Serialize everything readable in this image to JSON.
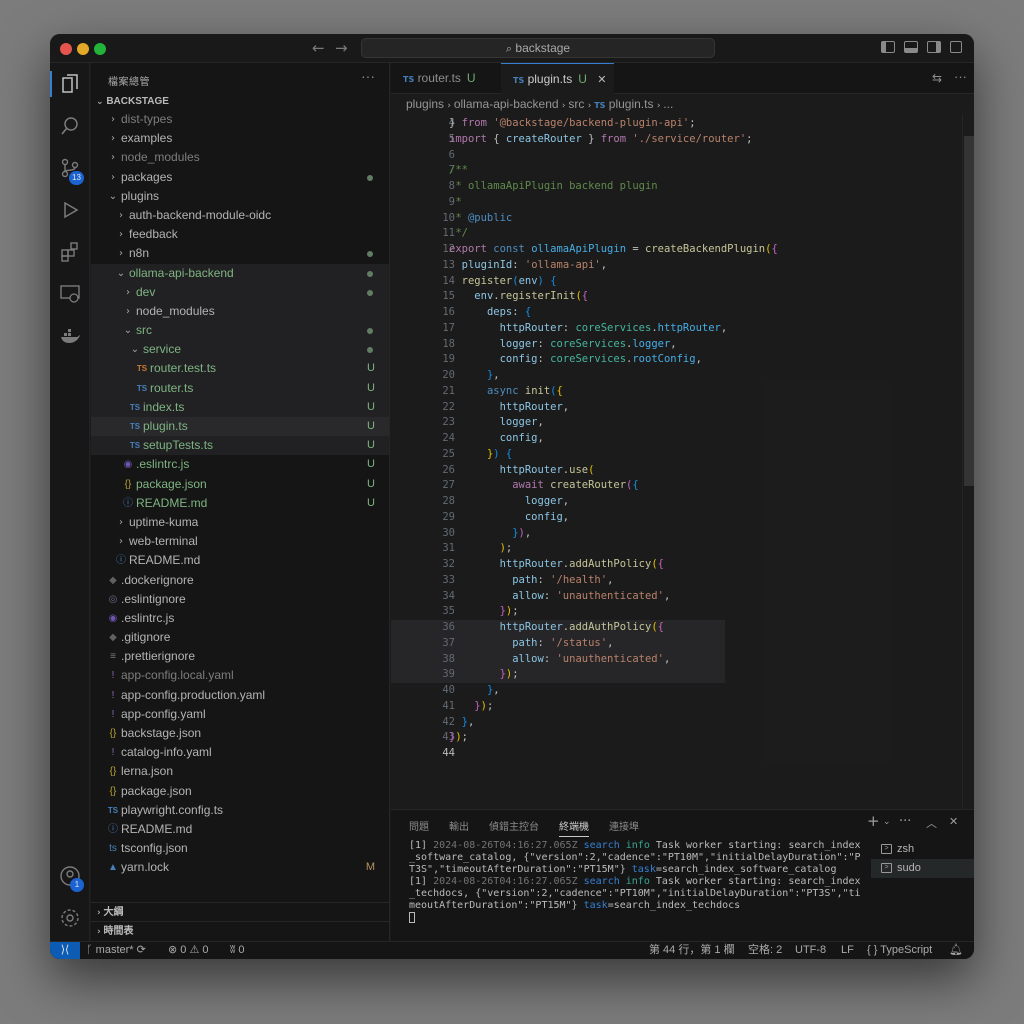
{
  "titlebar": {
    "search": "backstage"
  },
  "activity": {
    "scm_badge": "13",
    "account_badge": "1"
  },
  "sidebar": {
    "title": "檔案總管",
    "more": "···",
    "root": "BACKSTAGE",
    "tree": [
      {
        "label": "dist-types",
        "indent": 13,
        "chev": "›",
        "dim": true
      },
      {
        "label": "examples",
        "indent": 13,
        "chev": "›"
      },
      {
        "label": "node_modules",
        "indent": 13,
        "chev": "›",
        "dim": true
      },
      {
        "label": "packages",
        "indent": 13,
        "chev": "›",
        "dot": true
      },
      {
        "label": "plugins",
        "indent": 13,
        "chev": "⌄"
      },
      {
        "label": "auth-backend-module-oidc",
        "indent": 21,
        "chev": "›"
      },
      {
        "label": "feedback",
        "indent": 21,
        "chev": "›"
      },
      {
        "label": "n8n",
        "indent": 21,
        "chev": "›",
        "dot": true
      },
      {
        "label": "ollama-api-backend",
        "indent": 21,
        "chev": "⌄",
        "green": true,
        "dot": true,
        "hl": true
      },
      {
        "label": "dev",
        "indent": 28,
        "chev": "›",
        "green": true,
        "dot": true,
        "hl": true
      },
      {
        "label": "node_modules",
        "indent": 28,
        "chev": "›",
        "hl": true
      },
      {
        "label": "src",
        "indent": 28,
        "chev": "⌄",
        "green": true,
        "dot": true,
        "hl": true
      },
      {
        "label": "service",
        "indent": 35,
        "chev": "⌄",
        "green": true,
        "dot": true,
        "hl": true
      },
      {
        "label": "router.test.ts",
        "indent": 42,
        "icon": "TS",
        "iconColor": "#e0883a",
        "green": true,
        "status": "U",
        "hl": true
      },
      {
        "label": "router.ts",
        "indent": 42,
        "icon": "TS",
        "green": true,
        "status": "U",
        "hl": true
      },
      {
        "label": "index.ts",
        "indent": 35,
        "icon": "TS",
        "green": true,
        "status": "U",
        "hl": true
      },
      {
        "label": "plugin.ts",
        "indent": 35,
        "icon": "TS",
        "green": true,
        "status": "U",
        "sel": true
      },
      {
        "label": "setupTests.ts",
        "indent": 35,
        "icon": "TS",
        "green": true,
        "status": "U",
        "hl": true
      },
      {
        "label": ".eslintrc.js",
        "indent": 28,
        "icon": "◉",
        "iconColor": "#7b5fc4",
        "green": true,
        "status": "U"
      },
      {
        "label": "package.json",
        "indent": 28,
        "icon": "{}",
        "iconColor": "#c9b43a",
        "green": true,
        "status": "U"
      },
      {
        "label": "README.md",
        "indent": 28,
        "icon": "ⓘ",
        "iconColor": "#4e8fd1",
        "green": true,
        "status": "U"
      },
      {
        "label": "uptime-kuma",
        "indent": 21,
        "chev": "›"
      },
      {
        "label": "web-terminal",
        "indent": 21,
        "chev": "›"
      },
      {
        "label": "README.md",
        "indent": 21,
        "icon": "ⓘ",
        "iconColor": "#4e8fd1"
      },
      {
        "label": ".dockerignore",
        "indent": 13,
        "icon": "◆",
        "iconColor": "#6b6b6b"
      },
      {
        "label": ".eslintignore",
        "indent": 13,
        "icon": "◎",
        "iconColor": "#7b7b9b"
      },
      {
        "label": ".eslintrc.js",
        "indent": 13,
        "icon": "◉",
        "iconColor": "#7b5fc4"
      },
      {
        "label": ".gitignore",
        "indent": 13,
        "icon": "◆",
        "iconColor": "#6b6b6b"
      },
      {
        "label": ".prettierignore",
        "indent": 13,
        "icon": "≡",
        "iconColor": "#8a8a8a"
      },
      {
        "label": "app-config.local.yaml",
        "indent": 13,
        "icon": "!",
        "iconColor": "#a074c4",
        "dim": true
      },
      {
        "label": "app-config.production.yaml",
        "indent": 13,
        "icon": "!",
        "iconColor": "#a074c4"
      },
      {
        "label": "app-config.yaml",
        "indent": 13,
        "icon": "!",
        "iconColor": "#a074c4"
      },
      {
        "label": "backstage.json",
        "indent": 13,
        "icon": "{}",
        "iconColor": "#c9b43a"
      },
      {
        "label": "catalog-info.yaml",
        "indent": 13,
        "icon": "!",
        "iconColor": "#a074c4"
      },
      {
        "label": "lerna.json",
        "indent": 13,
        "icon": "{}",
        "iconColor": "#c9b43a"
      },
      {
        "label": "package.json",
        "indent": 13,
        "icon": "{}",
        "iconColor": "#c9b43a"
      },
      {
        "label": "playwright.config.ts",
        "indent": 13,
        "icon": "TS"
      },
      {
        "label": "README.md",
        "indent": 13,
        "icon": "ⓘ",
        "iconColor": "#4e8fd1"
      },
      {
        "label": "tsconfig.json",
        "indent": 13,
        "icon": "ts",
        "iconColor": "#4e8fd1"
      },
      {
        "label": "yarn.lock",
        "indent": 13,
        "icon": "▲",
        "iconColor": "#4e8fd1",
        "status": "M",
        "statusColor": "#c9a26b"
      }
    ],
    "outline": "大綱",
    "timeline": "時間表"
  },
  "tabs": [
    {
      "label": "router.ts",
      "status": "U",
      "active": false
    },
    {
      "label": "plugin.ts",
      "status": "U",
      "active": true
    }
  ],
  "breadcrumb": [
    "plugins",
    "ollama-api-backend",
    "src",
    "plugin.ts",
    "..."
  ],
  "code": {
    "lines": [
      {
        "n": 4,
        "html": "<span style=\"color:#cfcfcf\">} </span><span style=\"color:#c586c0\">from</span> <span style=\"color:#ce9178\">'@backstage/backend-plugin-api'</span>;"
      },
      {
        "n": 5,
        "html": "<span style=\"color:#c586c0\">import</span> { <span style=\"color:#9cdcfe\">createRouter</span> } <span style=\"color:#c586c0\">from</span> <span style=\"color:#ce9178\">'./service/router'</span>;"
      },
      {
        "n": 6,
        "html": ""
      },
      {
        "n": 7,
        "html": "<span style=\"color:#6a9955\">/**</span>"
      },
      {
        "n": 8,
        "html": "<span style=\"color:#6a9955\"> * ollamaApiPlugin backend plugin</span>"
      },
      {
        "n": 9,
        "html": "<span style=\"color:#6a9955\"> *</span>"
      },
      {
        "n": 10,
        "html": "<span style=\"color:#6a9955\"> * </span><span style=\"color:#569cd6\">@public</span>"
      },
      {
        "n": 11,
        "html": "<span style=\"color:#6a9955\"> */</span>"
      },
      {
        "n": 12,
        "html": "<span style=\"color:#c586c0\">export</span> <span style=\"color:#569cd6\">const</span> <span style=\"color:#4fc1ff\">ollamaApiPlugin</span> = <span style=\"color:#dcdcaa\">createBackendPlugin</span><span style=\"color:#ffd700\">(</span><span style=\"color:#da70d6\">{</span>"
      },
      {
        "n": 13,
        "html": "  <span style=\"color:#9cdcfe\">pluginId</span>: <span style=\"color:#ce9178\">'ollama-api'</span>,"
      },
      {
        "n": 14,
        "html": "  <span style=\"color:#dcdcaa\">register</span><span style=\"color:#179fff\">(</span><span style=\"color:#9cdcfe\">env</span><span style=\"color:#179fff\">)</span> <span style=\"color:#179fff\">{</span>"
      },
      {
        "n": 15,
        "html": "    <span style=\"color:#9cdcfe\">env</span>.<span style=\"color:#dcdcaa\">registerInit</span><span style=\"color:#ffd700\">(</span><span style=\"color:#da70d6\">{</span>"
      },
      {
        "n": 16,
        "html": "      <span style=\"color:#9cdcfe\">deps</span>: <span style=\"color:#179fff\">{</span>"
      },
      {
        "n": 17,
        "html": "        <span style=\"color:#9cdcfe\">httpRouter</span>: <span style=\"color:#4ec9b0\">coreServices</span>.<span style=\"color:#4fc1ff\">httpRouter</span>,"
      },
      {
        "n": 18,
        "html": "        <span style=\"color:#9cdcfe\">logger</span>: <span style=\"color:#4ec9b0\">coreServices</span>.<span style=\"color:#4fc1ff\">logger</span>,"
      },
      {
        "n": 19,
        "html": "        <span style=\"color:#9cdcfe\">config</span>: <span style=\"color:#4ec9b0\">coreServices</span>.<span style=\"color:#4fc1ff\">rootConfig</span>,"
      },
      {
        "n": 20,
        "html": "      <span style=\"color:#179fff\">}</span>,"
      },
      {
        "n": 21,
        "html": "      <span style=\"color:#569cd6\">async</span> <span style=\"color:#dcdcaa\">init</span><span style=\"color:#179fff\">(</span><span style=\"color:#ffd700\">{</span>"
      },
      {
        "n": 22,
        "html": "        <span style=\"color:#9cdcfe\">httpRouter</span>,"
      },
      {
        "n": 23,
        "html": "        <span style=\"color:#9cdcfe\">logger</span>,"
      },
      {
        "n": 24,
        "html": "        <span style=\"color:#9cdcfe\">config</span>,"
      },
      {
        "n": 25,
        "html": "      <span style=\"color:#ffd700\">}</span><span style=\"color:#179fff\">)</span> <span style=\"color:#179fff\">{</span>"
      },
      {
        "n": 26,
        "html": "        <span style=\"color:#9cdcfe\">httpRouter</span>.<span style=\"color:#dcdcaa\">use</span><span style=\"color:#ffd700\">(</span>"
      },
      {
        "n": 27,
        "html": "          <span style=\"color:#c586c0\">await</span> <span style=\"color:#dcdcaa\">createRouter</span><span style=\"color:#da70d6\">(</span><span style=\"color:#179fff\">{</span>"
      },
      {
        "n": 28,
        "html": "            <span style=\"color:#9cdcfe\">logger</span>,"
      },
      {
        "n": 29,
        "html": "            <span style=\"color:#9cdcfe\">config</span>,"
      },
      {
        "n": 30,
        "html": "          <span style=\"color:#179fff\">}</span><span style=\"color:#da70d6\">)</span>,"
      },
      {
        "n": 31,
        "html": "        <span style=\"color:#ffd700\">)</span>;"
      },
      {
        "n": 32,
        "html": "        <span style=\"color:#9cdcfe\">httpRouter</span>.<span style=\"color:#dcdcaa\">addAuthPolicy</span><span style=\"color:#ffd700\">(</span><span style=\"color:#da70d6\">{</span>"
      },
      {
        "n": 33,
        "html": "          <span style=\"color:#9cdcfe\">path</span>: <span style=\"color:#ce9178\">'/health'</span>,"
      },
      {
        "n": 34,
        "html": "          <span style=\"color:#9cdcfe\">allow</span>: <span style=\"color:#ce9178\">'unauthenticated'</span>,"
      },
      {
        "n": 35,
        "html": "        <span style=\"color:#da70d6\">}</span><span style=\"color:#ffd700\">)</span>;"
      },
      {
        "n": 36,
        "hl": true,
        "html": "        <span style=\"color:#9cdcfe\">httpRouter</span>.<span style=\"color:#dcdcaa\">addAuthPolicy</span><span style=\"color:#ffd700\">(</span><span style=\"color:#da70d6\">{</span>"
      },
      {
        "n": 37,
        "hl": true,
        "html": "          <span style=\"color:#9cdcfe\">path</span>: <span style=\"color:#ce9178\">'/status'</span>,"
      },
      {
        "n": 38,
        "hl": true,
        "html": "          <span style=\"color:#9cdcfe\">allow</span>: <span style=\"color:#ce9178\">'unauthenticated'</span>,"
      },
      {
        "n": 39,
        "hl": true,
        "html": "        <span style=\"color:#da70d6\">}</span><span style=\"color:#ffd700\">)</span>;"
      },
      {
        "n": 40,
        "html": "      <span style=\"color:#179fff\">}</span>,"
      },
      {
        "n": 41,
        "html": "    <span style=\"color:#da70d6\">}</span><span style=\"color:#ffd700\">)</span>;"
      },
      {
        "n": 42,
        "html": "  <span style=\"color:#179fff\">}</span>,"
      },
      {
        "n": 43,
        "html": "<span style=\"color:#da70d6\">}</span><span style=\"color:#ffd700\">)</span>;"
      },
      {
        "n": 44,
        "cur": true,
        "html": ""
      }
    ]
  },
  "panel": {
    "tabs": [
      "問題",
      "輸出",
      "偵錯主控台",
      "終端機",
      "連接埠"
    ],
    "active_tab": "終端機",
    "terminal_lines": [
      {
        "prefix": "[1] ",
        "date": "2024-08-26T04:16:27.065Z",
        "src": " search",
        "level": " info",
        "text": " Task worker starting: search_index_software_catalog, {\"version\":2,\"cadence\":\"PT10M\",\"initialDelayDuration\":\"PT3S\",\"timeoutAfterDuration\":\"PT15M\"} ",
        "key": "task",
        "val": "=search_index_software_catalog"
      },
      {
        "prefix": "[1] ",
        "date": "2024-08-26T04:16:27.065Z",
        "src": " search",
        "level": " info",
        "text": " Task worker starting: search_index_techdocs, {\"version\":2,\"cadence\":\"PT10M\",\"initialDelayDuration\":\"PT3S\",\"timeoutAfterDuration\":\"PT15M\"} ",
        "key": "task",
        "val": "=search_index_techdocs"
      }
    ],
    "shells": [
      {
        "label": "zsh",
        "active": false
      },
      {
        "label": "sudo",
        "active": true
      }
    ]
  },
  "statusbar": {
    "branch": "master*",
    "errors": "0",
    "warnings": "0",
    "ports": "0",
    "position": "第 44 行，第 1 欄",
    "indent": "空格: 2",
    "encoding": "UTF-8",
    "eol": "LF",
    "language": "TypeScript"
  }
}
